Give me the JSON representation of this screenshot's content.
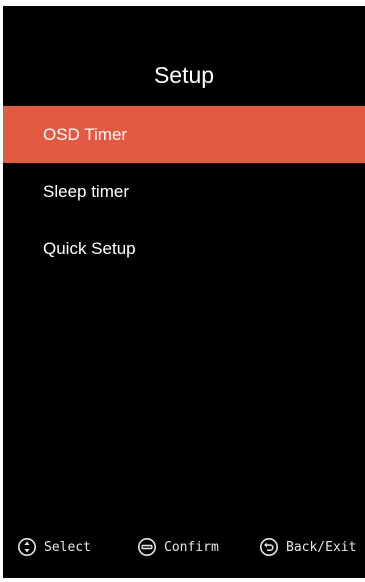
{
  "menu": {
    "title": "Setup",
    "items": [
      {
        "label": "OSD Timer",
        "selected": true
      },
      {
        "label": "Sleep timer",
        "selected": false
      },
      {
        "label": "Quick Setup",
        "selected": false
      }
    ]
  },
  "footer": {
    "hints": [
      {
        "icon": "navigate-icon",
        "label": "Select"
      },
      {
        "icon": "enter-icon",
        "label": "Confirm"
      },
      {
        "icon": "back-icon",
        "label": "Back/Exit"
      }
    ]
  },
  "colors": {
    "background": "#000000",
    "highlight": "#e35a43",
    "text": "#ffffff"
  }
}
